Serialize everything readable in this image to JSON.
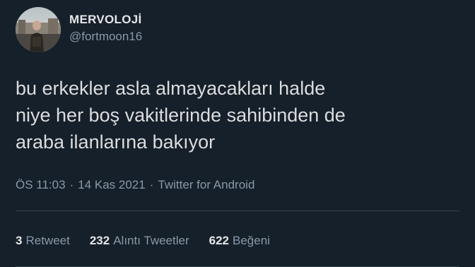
{
  "user": {
    "display_name": "MERVOLOJİ",
    "handle": "@fortmoon16"
  },
  "tweet": {
    "lines": [
      "bu erkekler asla almayacakları halde",
      "niye her boş vakitlerinde sahibinden de",
      "araba ilanlarına bakıyor"
    ],
    "time": "ÖS 11:03",
    "separator": "·",
    "date": "14 Kas 2021",
    "source": "Twitter for Android"
  },
  "stats": {
    "retweets": {
      "count": "3",
      "label": "Retweet"
    },
    "quotes": {
      "count": "232",
      "label": "Alıntı Tweetler"
    },
    "likes": {
      "count": "622",
      "label": "Beğeni"
    }
  },
  "colors": {
    "background": "#15202b",
    "text": "#d9d9d9",
    "secondary": "#8b98a5",
    "divider": "#38444d"
  }
}
